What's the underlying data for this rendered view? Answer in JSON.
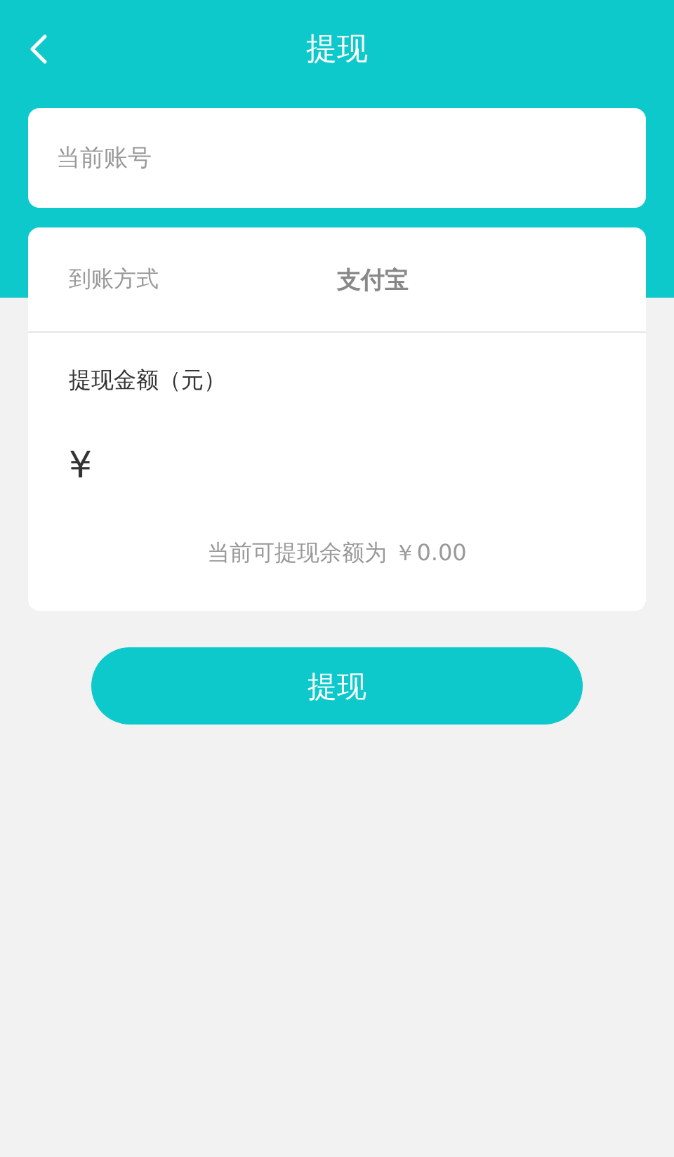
{
  "header": {
    "title": "提现"
  },
  "account": {
    "placeholder": "当前账号"
  },
  "method": {
    "label": "到账方式",
    "value": "支付宝"
  },
  "amount": {
    "label": "提现金额（元）",
    "currency": "¥"
  },
  "balance": "当前可提现余额为 ￥0.00",
  "submit": "提现"
}
